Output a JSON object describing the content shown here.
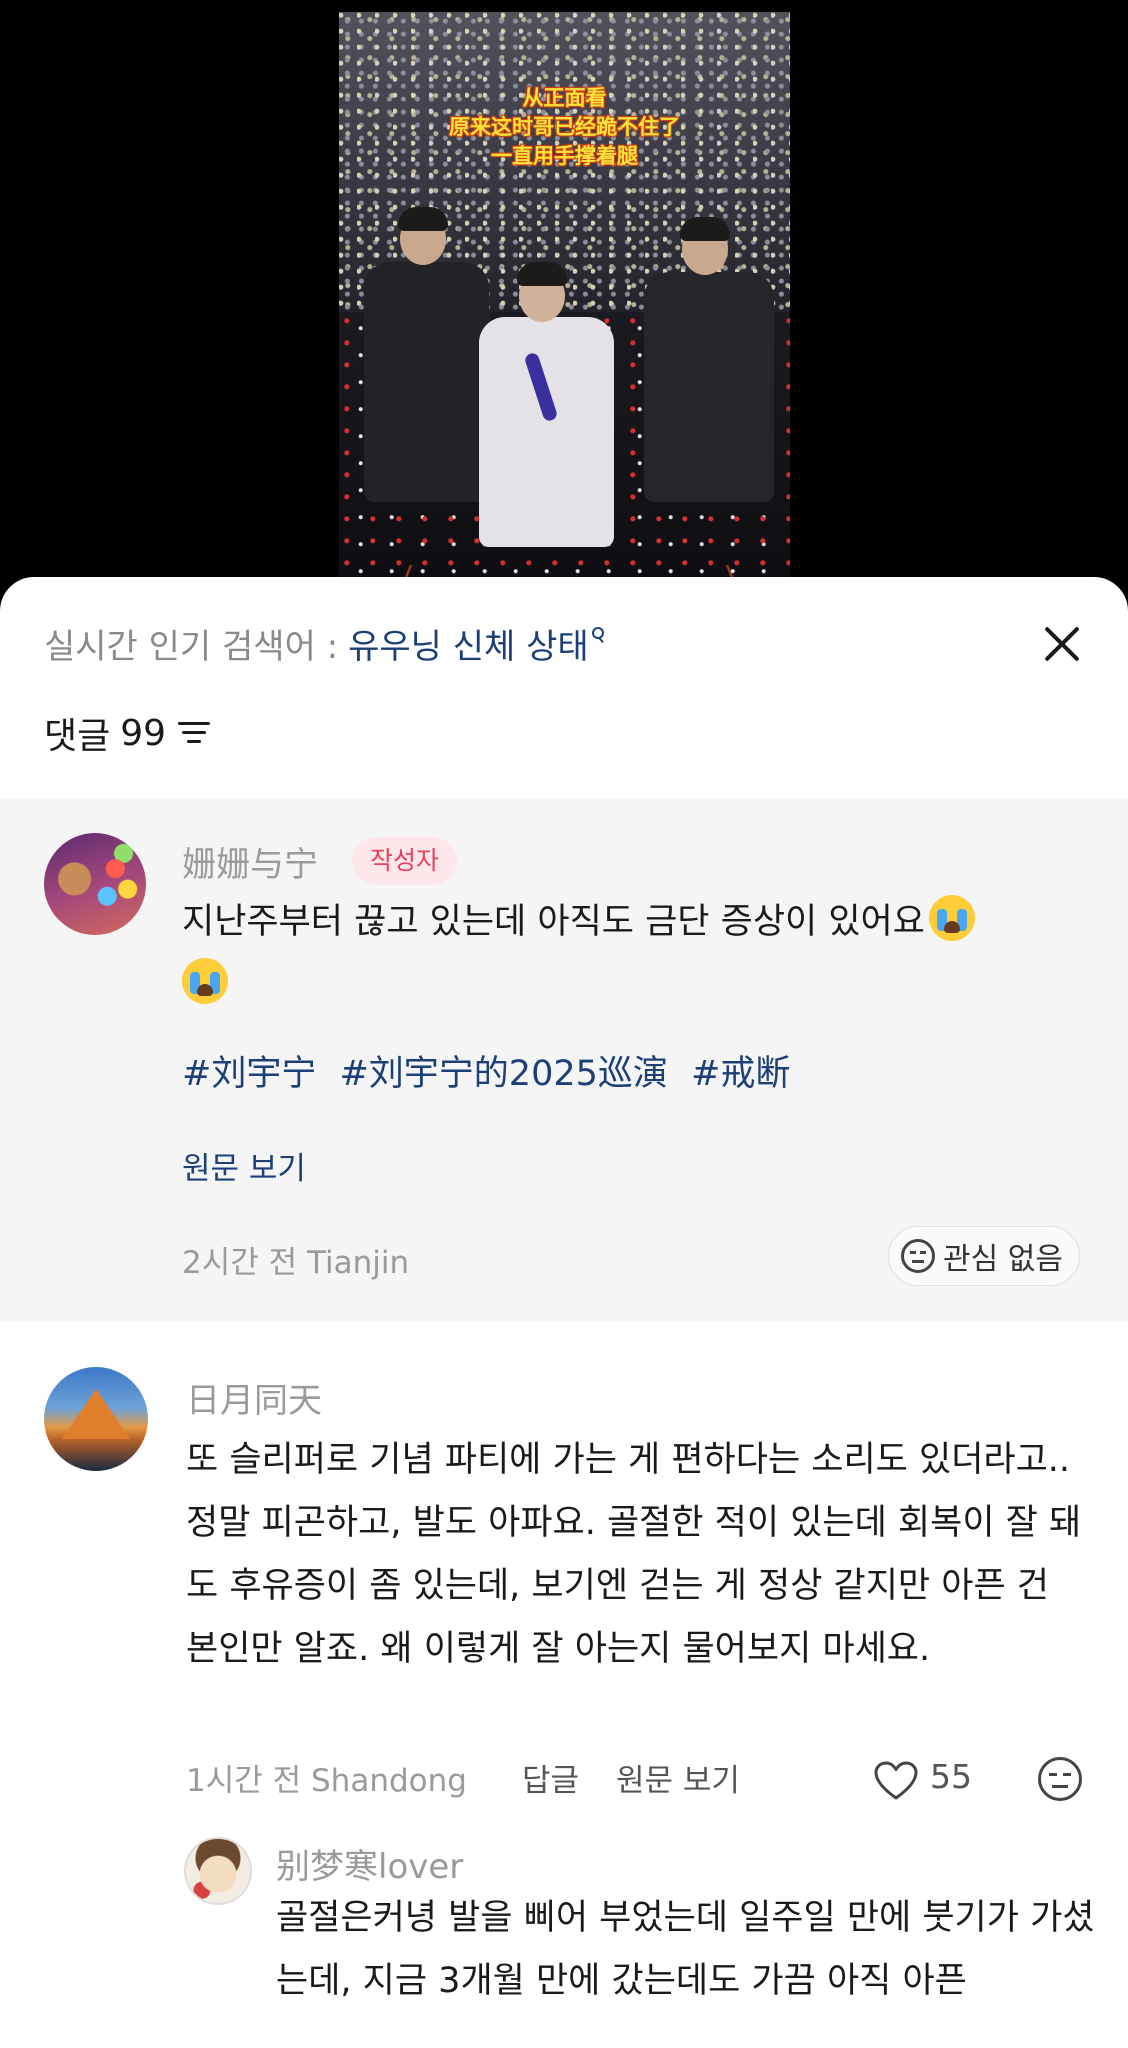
{
  "video": {
    "caption_lines": [
      "从正面看",
      "原来这时哥已经跪不住了",
      "一直用手撑着腿"
    ]
  },
  "trend": {
    "prefix": "실시간 인기 검색어 :",
    "term": "유우닝 신체 상태"
  },
  "comments_header": {
    "label": "댓글",
    "count": "99"
  },
  "pinned_comment": {
    "author": "姗姗与宁",
    "badge": "작성자",
    "text": "지난주부터 끊고 있는데 아직도 금단 증상이 있어요",
    "hashtags": [
      "#刘宇宁",
      "#刘宇宁的2025巡演",
      "#戒断"
    ],
    "view_original": "원문 보기",
    "meta": "2시간 전 Tianjin",
    "not_interested": "관심 없음"
  },
  "comment_2": {
    "author": "日月同天",
    "text": "또 슬리퍼로 기념 파티에 가는 게 편하다는 소리도 있더라고.. 정말 피곤하고, 발도 아파요. 골절한 적이 있는데 회복이 잘 돼도 후유증이 좀 있는데, 보기엔 걷는 게 정상 같지만 아픈 건 본인만 알죠. 왜 이렇게 잘 아는지 물어보지 마세요.",
    "meta": "1시간 전 Shandong",
    "reply_label": "답글",
    "view_original": "원문 보기",
    "likes": "55"
  },
  "reply_1": {
    "author": "别梦寒lover",
    "text": "골절은커녕 발을 삐어 부었는데 일주일 만에 붓기가 가셨는데, 지금 3개월 만에 갔는데도 가끔 아직 아픈"
  }
}
